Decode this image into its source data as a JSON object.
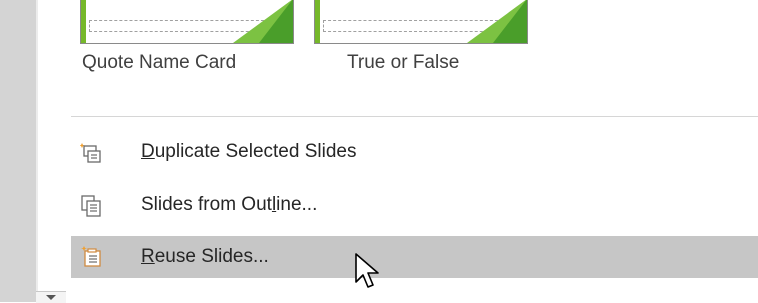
{
  "layouts": [
    {
      "label": "Quote Name Card"
    },
    {
      "label": "True or False"
    }
  ],
  "menu": {
    "items": [
      {
        "pre": "",
        "key": "D",
        "post": "uplicate Selected Slides",
        "icon": "duplicate-slides-icon"
      },
      {
        "pre": "Slides from Out",
        "key": "l",
        "post": "ine...",
        "icon": "slides-from-outline-icon"
      },
      {
        "pre": "",
        "key": "R",
        "post": "euse Slides...",
        "icon": "reuse-slides-icon"
      }
    ]
  },
  "colors": {
    "hover_background": "#c6c6c6",
    "icon_accent": "#f0a030",
    "thumbnail_green": "#7cc242"
  }
}
